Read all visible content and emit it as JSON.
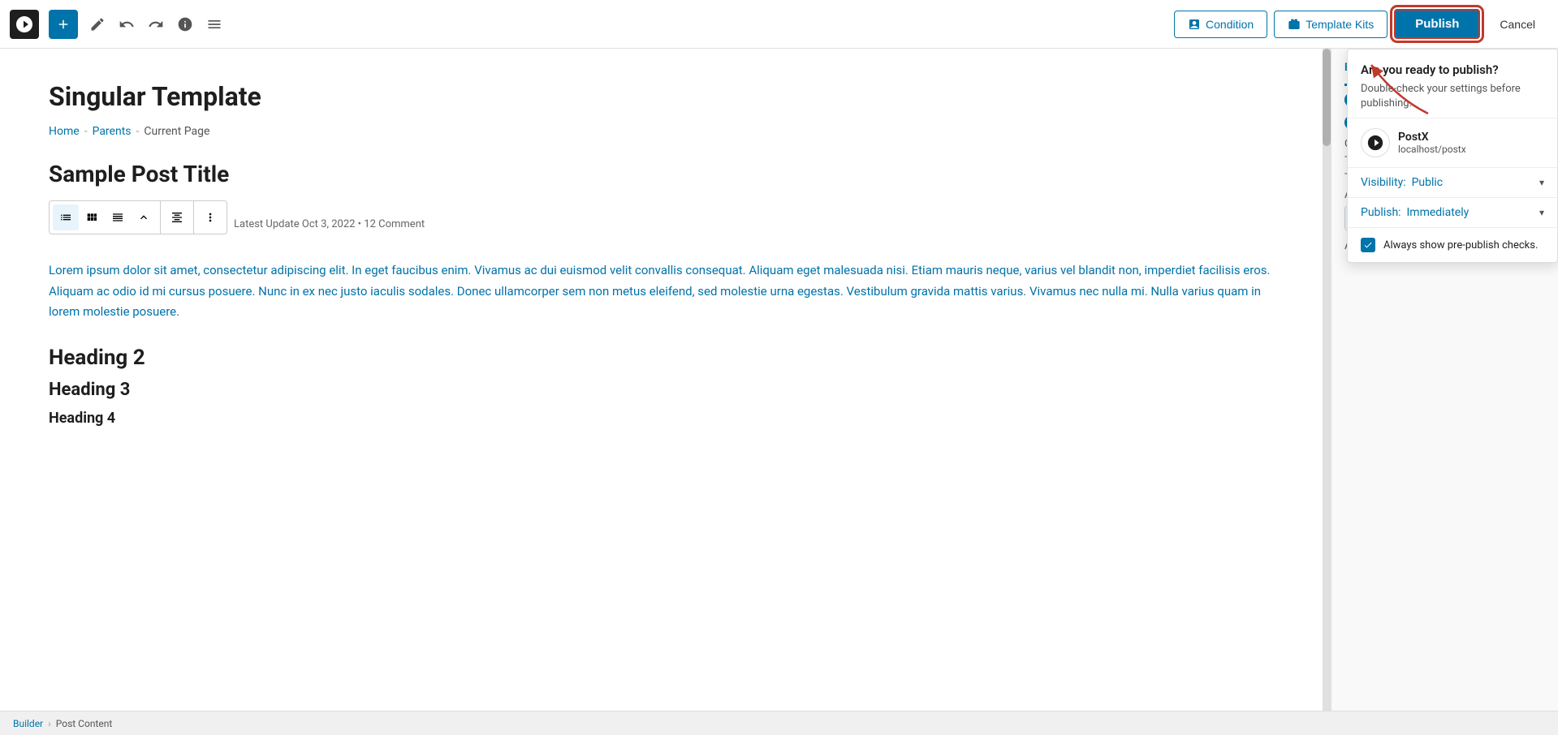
{
  "toolbar": {
    "add_button_title": "+",
    "undo_title": "Undo",
    "redo_title": "Redo",
    "info_title": "Info",
    "menu_title": "Menu",
    "condition_label": "Condition",
    "template_kits_label": "Template Kits",
    "publish_label": "Publish",
    "cancel_label": "Cancel"
  },
  "canvas": {
    "page_title": "Singular Template",
    "breadcrumb": {
      "home": "Home",
      "parents": "Parents",
      "current": "Current Page"
    },
    "post_title": "Sample Post Title",
    "block_meta": "Latest Update Oct 3, 2022  •  12 Comment",
    "post_content": "Lorem ipsum dolor sit amet, consectetur adipiscing elit. In eget faucibus enim. Vivamus ac dui euismod velit convallis consequat. Aliquam eget malesuada nisi. Etiam mauris neque, varius vel blandit non, imperdiet facilisis eros. Aliquam ac odio id mi cursus posuere. Nunc in ex nec justo iaculis sodales. Donec ullamcorper sem non metus eleifend, sed molestie urna egestas. Vestibulum gravida mattis varius. Vivamus nec nulla mi. Nulla varius quam in lorem molestie posuere.",
    "heading2": "Heading 2",
    "heading3": "Heading 3",
    "heading4_preview": "Heading 4"
  },
  "publish_panel": {
    "title": "Are you ready to publish?",
    "subtitle": "Double-check your settings before publishing.",
    "site_name": "PostX",
    "site_url": "localhost/postx",
    "visibility_label": "Visibility:",
    "visibility_value": "Public",
    "publish_label": "Publish:",
    "publish_value": "Immediately",
    "checkbox_label": "Always show pre-publish checks."
  },
  "builder_panel": {
    "build_label": "Build",
    "con_label": "Con",
    "text_label": "Text",
    "type_label": "Type",
    "align_label": "Align",
    "adv_label": "Adv"
  },
  "status_bar": {
    "part1": "Builder",
    "separator": "›",
    "part2": "Post Content"
  }
}
